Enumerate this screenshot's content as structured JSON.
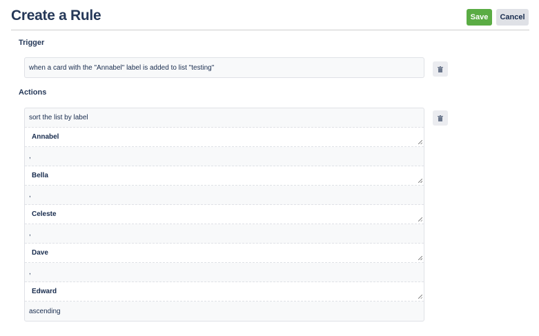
{
  "header": {
    "title": "Create a Rule",
    "save_label": "Save",
    "cancel_label": "Cancel"
  },
  "trigger": {
    "label": "Trigger",
    "value": "when a card with the \"Annabel\" label is added to list \"testing\""
  },
  "actions": {
    "label": "Actions",
    "rows": [
      {
        "type": "text",
        "value": "sort the list by label"
      },
      {
        "type": "textarea",
        "value": "Annabel"
      },
      {
        "type": "text",
        "value": ","
      },
      {
        "type": "textarea",
        "value": "Bella"
      },
      {
        "type": "text",
        "value": ","
      },
      {
        "type": "textarea",
        "value": "Celeste"
      },
      {
        "type": "text",
        "value": ","
      },
      {
        "type": "textarea",
        "value": "Dave"
      },
      {
        "type": "text",
        "value": ","
      },
      {
        "type": "textarea",
        "value": "Edward"
      },
      {
        "type": "text",
        "value": "ascending"
      }
    ]
  }
}
